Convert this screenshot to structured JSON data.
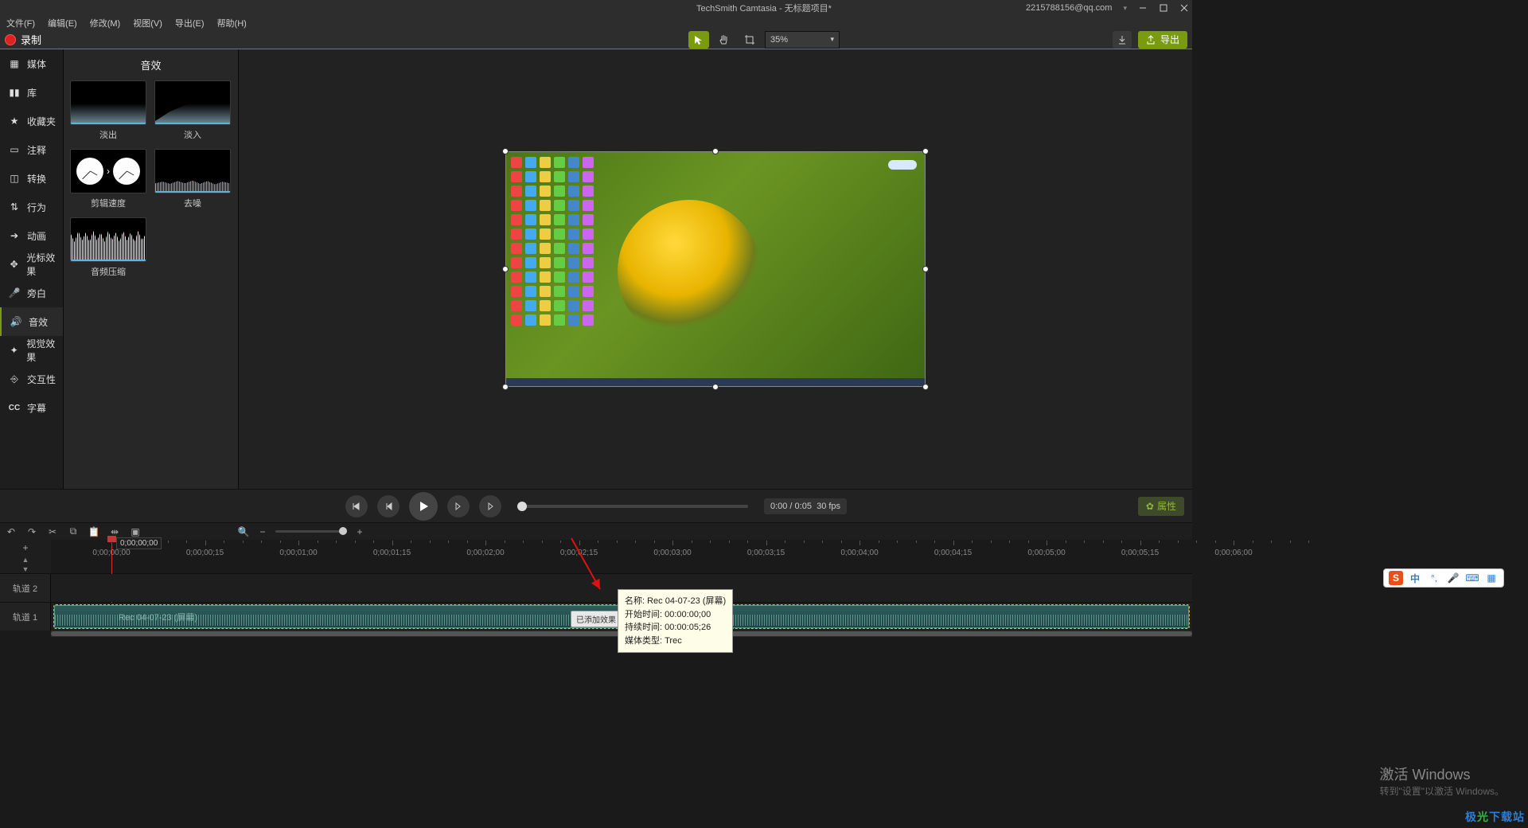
{
  "window": {
    "title": "TechSmith Camtasia - 无标题项目*",
    "account": "2215788156@qq.com",
    "menus": [
      "文件(F)",
      "编辑(E)",
      "修改(M)",
      "视图(V)",
      "导出(E)",
      "帮助(H)"
    ]
  },
  "toolbar": {
    "record_label": "录制",
    "zoom_value": "35%",
    "export_label": "导出"
  },
  "sidebar": {
    "items": [
      {
        "label": "媒体",
        "icon": "film-icon"
      },
      {
        "label": "库",
        "icon": "books-icon"
      },
      {
        "label": "收藏夹",
        "icon": "star-icon"
      },
      {
        "label": "注释",
        "icon": "callout-icon"
      },
      {
        "label": "转换",
        "icon": "transition-icon"
      },
      {
        "label": "行为",
        "icon": "behavior-icon"
      },
      {
        "label": "动画",
        "icon": "arrow-icon"
      },
      {
        "label": "光标效果",
        "icon": "cursor-icon"
      },
      {
        "label": "旁白",
        "icon": "mic-icon"
      },
      {
        "label": "音效",
        "icon": "speaker-icon"
      },
      {
        "label": "视觉效果",
        "icon": "wand-icon"
      },
      {
        "label": "交互性",
        "icon": "interact-icon"
      },
      {
        "label": "字幕",
        "icon": "cc-icon"
      }
    ],
    "active_index": 9
  },
  "panel": {
    "title": "音效",
    "thumbs": [
      {
        "label": "淡出",
        "kind": "waveout"
      },
      {
        "label": "淡入",
        "kind": "wavein"
      },
      {
        "label": "剪辑速度",
        "kind": "clocks"
      },
      {
        "label": "去噪",
        "kind": "denoise"
      },
      {
        "label": "音频压缩",
        "kind": "compress"
      }
    ]
  },
  "playback": {
    "time_label": "0:00 / 0:05",
    "fps_label": "30 fps",
    "properties_label": "属性"
  },
  "timeline": {
    "playhead_time": "0;00;00;00",
    "ticks": [
      "0;00;00;00",
      "0;00;00;15",
      "0;00;01;00",
      "0;00;01;15",
      "0;00;02;00",
      "0;00;02;15",
      "0;00;03;00",
      "0;00;03;15",
      "0;00;04;00",
      "0;00;04;15",
      "0;00;05;00",
      "0;00;05;15",
      "0;00;06;00"
    ],
    "tracks": [
      {
        "name": "轨道 2"
      },
      {
        "name": "轨道 1"
      }
    ],
    "clip_label": "Rec 04-07-23 (屏幕)",
    "fx_badge": "已添加效果"
  },
  "tooltip": {
    "l1": "名称: Rec 04-07-23 (屏幕)",
    "l2": "开始时间: 00:00:00;00",
    "l3": "持续时间:    00:00:05;26",
    "l4": "媒体类型: Trec"
  },
  "activation": {
    "title": "激活 Windows",
    "sub": "转到\"设置\"以激活 Windows。"
  },
  "ime": {
    "letter": "S",
    "lang": "中"
  }
}
